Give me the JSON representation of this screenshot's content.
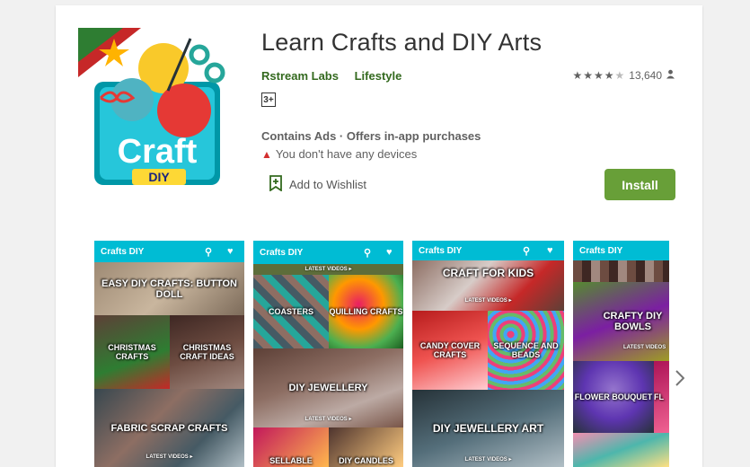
{
  "app": {
    "title": "Learn Crafts and DIY Arts",
    "developer": "Rstream Labs",
    "category": "Lifestyle",
    "rating_count": "13,640",
    "rating_stars": 4.5,
    "content_rating": "3+",
    "ads_notice": "Contains Ads · Offers in-app purchases",
    "devices_notice": "You don't have any devices",
    "wishlist_label": "Add to Wishlist",
    "install_label": "Install",
    "icon": {
      "word": "Craft",
      "badge": "DIY"
    }
  },
  "colors": {
    "accent_green": "#689f38",
    "link_green": "#33691e",
    "appbar_cyan": "#00bcd4",
    "warn_red": "#d32f2f"
  },
  "screenshots": [
    {
      "bar_title": "Crafts DIY",
      "tiles": [
        "EASY DIY CRAFTS: BUTTON DOLL",
        "CHRISTMAS CRAFTS",
        "CHRISTMAS CRAFT IDEAS",
        "FABRIC SCRAP CRAFTS"
      ],
      "tile_caption": "LATEST VIDEOS ▸"
    },
    {
      "bar_title": "Crafts DIY",
      "top_caption": "LATEST VIDEOS ▸",
      "tiles": [
        "COASTERS",
        "QUILLING CRAFTS",
        "DIY JEWELLERY",
        "SELLABLE",
        "DIY CANDLES"
      ],
      "tile_caption": "LATEST VIDEOS ▸"
    },
    {
      "bar_title": "Crafts DIY",
      "tiles": [
        "CRAFT FOR KIDS",
        "CANDY COVER CRAFTS",
        "SEQUENCE AND BEADS",
        "DIY JEWELLERY ART"
      ],
      "tile_caption": "LATEST VIDEOS ▸"
    },
    {
      "bar_title": "Crafts DIY",
      "tiles": [
        "CRAFTY DIY BOWLS",
        "FLOWER BOUQUET",
        "FL"
      ],
      "tile_caption": "LATEST VIDEOS"
    }
  ],
  "icons": [
    "search-icon",
    "heart-icon",
    "wishlist-icon",
    "warning-icon",
    "person-icon",
    "chevron-right-icon"
  ]
}
